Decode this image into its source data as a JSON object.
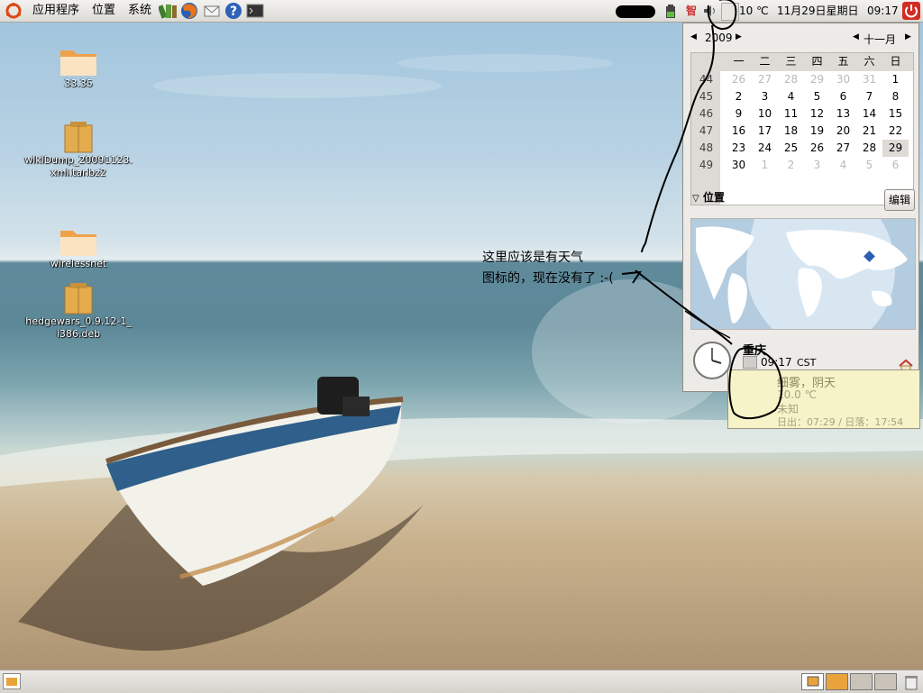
{
  "top_panel": {
    "menus": [
      "应用程序",
      "位置",
      "系统"
    ],
    "launchers": [
      "books-icon",
      "firefox-icon",
      "mail-icon",
      "help-icon",
      "terminal-icon"
    ],
    "tray": {
      "ime_label": "智",
      "temperature": "10 ℃",
      "date": "11月29日星期日",
      "time": "09:17"
    }
  },
  "desktop_icons": [
    {
      "name": "33.35",
      "icon": "folder-icon"
    },
    {
      "name": "wikiDump_20091123.\nxml.tar.bz2",
      "icon": "archive-icon"
    },
    {
      "name": "wirelessnet",
      "icon": "folder-icon"
    },
    {
      "name": "hedgewars_0.9.12-1_\ni386.deb",
      "icon": "package-icon"
    }
  ],
  "annotation": {
    "line1": "这里应该是有天气",
    "line2": "图标的，现在没有了 :-("
  },
  "calendar": {
    "year": "2009",
    "month": "十一月",
    "weekday_headers": [
      "一",
      "二",
      "三",
      "四",
      "五",
      "六",
      "日"
    ],
    "weeks": [
      {
        "week": "44",
        "days": [
          "26",
          "27",
          "28",
          "29",
          "30",
          "31",
          "1"
        ],
        "other": [
          true,
          true,
          true,
          true,
          true,
          true,
          false
        ]
      },
      {
        "week": "45",
        "days": [
          "2",
          "3",
          "4",
          "5",
          "6",
          "7",
          "8"
        ],
        "other": [
          false,
          false,
          false,
          false,
          false,
          false,
          false
        ]
      },
      {
        "week": "46",
        "days": [
          "9",
          "10",
          "11",
          "12",
          "13",
          "14",
          "15"
        ],
        "other": [
          false,
          false,
          false,
          false,
          false,
          false,
          false
        ]
      },
      {
        "week": "47",
        "days": [
          "16",
          "17",
          "18",
          "19",
          "20",
          "21",
          "22"
        ],
        "other": [
          false,
          false,
          false,
          false,
          false,
          false,
          false
        ]
      },
      {
        "week": "48",
        "days": [
          "23",
          "24",
          "25",
          "26",
          "27",
          "28",
          "29"
        ],
        "other": [
          false,
          false,
          false,
          false,
          false,
          false,
          false
        ]
      },
      {
        "week": "49",
        "days": [
          "30",
          "1",
          "2",
          "3",
          "4",
          "5",
          "6"
        ],
        "other": [
          false,
          true,
          true,
          true,
          true,
          true,
          true
        ]
      }
    ],
    "selected_day": "29",
    "locations_label": "位置",
    "edit_button": "编辑",
    "location": {
      "city": "重庆",
      "time": "09:17",
      "tz": "CST"
    }
  },
  "weather_tooltip": {
    "condition": "细雾，阴天",
    "temperature": "10.0 ℃",
    "status": "未知",
    "sun": "日出：07:29 / 日落：17:54"
  },
  "colors": {
    "panel": "#dcdad5",
    "accent_orange": "#e8a33c",
    "tooltip_bg": "#f6f3c9",
    "shutdown_red": "#d22c22"
  }
}
